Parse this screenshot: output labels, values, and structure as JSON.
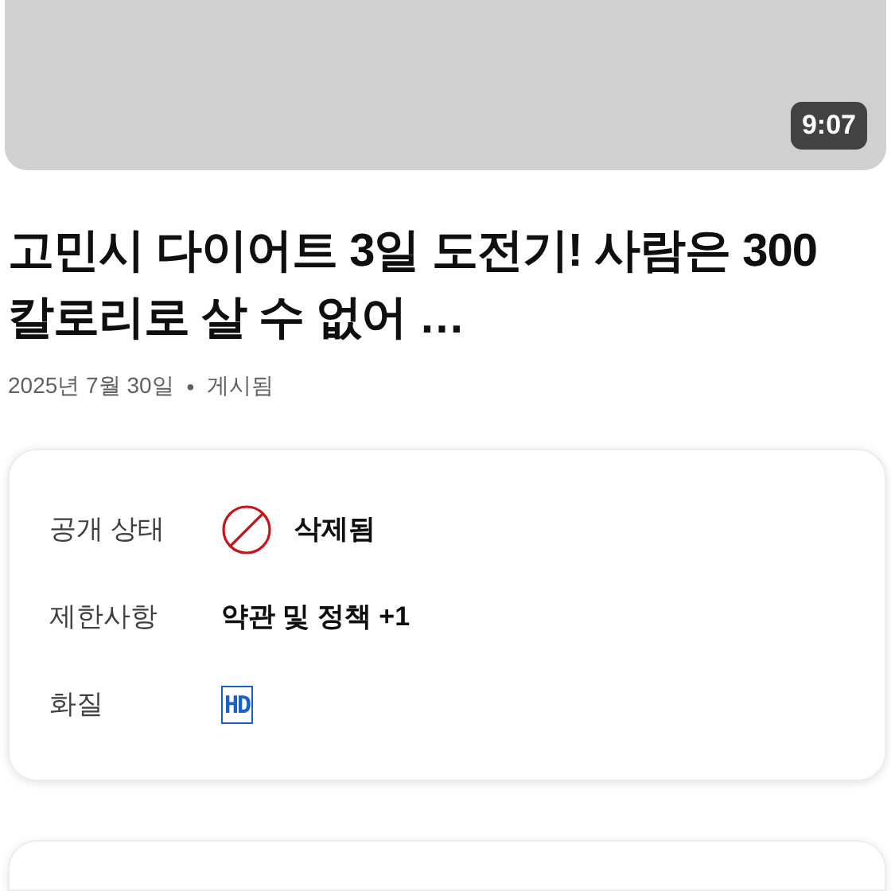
{
  "video": {
    "duration": "9:07"
  },
  "title": "고민시 다이어트 3일 도전기! 사람은 300칼로리로 살 수 없어 …",
  "meta": {
    "date": "2025년 7월 30일",
    "separator": "•",
    "status": "게시됨"
  },
  "details": [
    {
      "label": "공개 상태",
      "kind": "status",
      "value": "삭제됨"
    },
    {
      "label": "제한사항",
      "kind": "text",
      "value": "약관 및 정책 +1"
    },
    {
      "label": "화질",
      "kind": "badge",
      "value": "HD"
    }
  ]
}
